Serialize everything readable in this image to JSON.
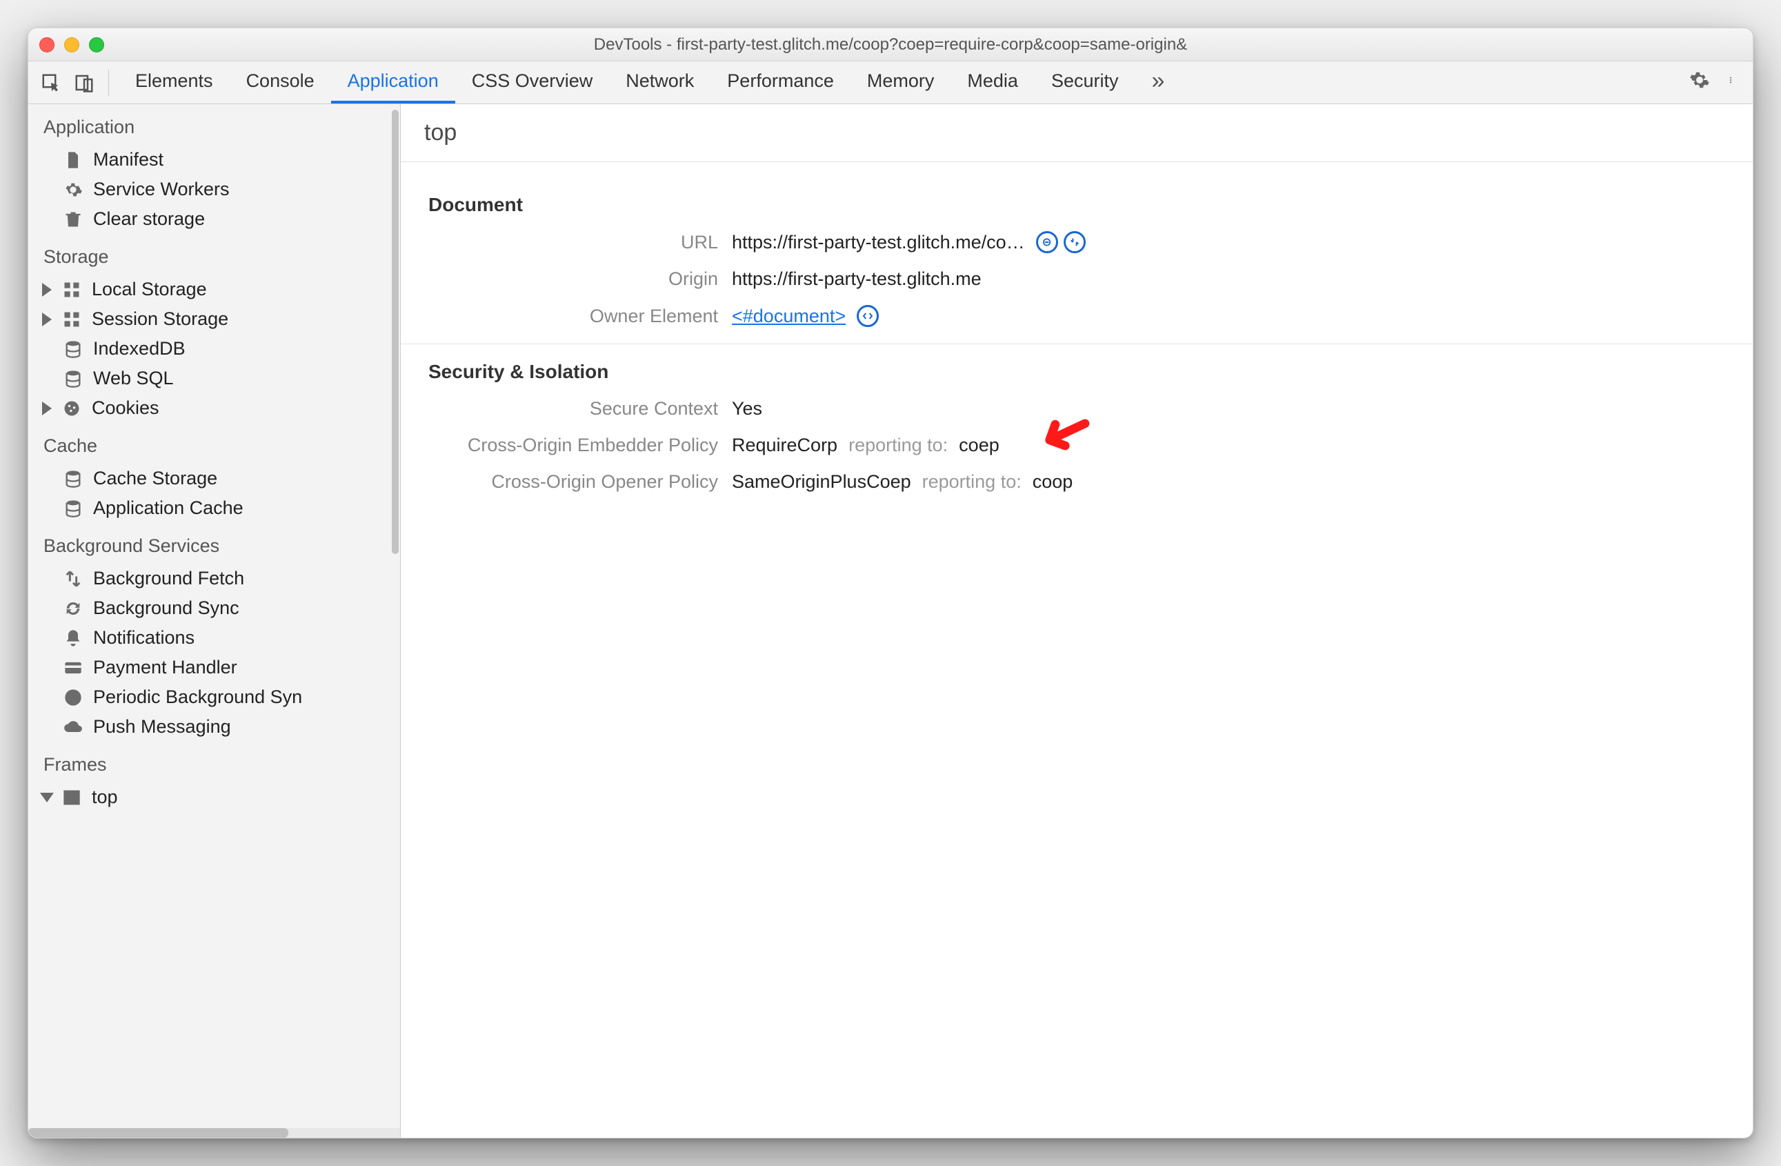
{
  "window": {
    "title": "DevTools - first-party-test.glitch.me/coop?coep=require-corp&coop=same-origin&"
  },
  "tabs": {
    "items": [
      "Elements",
      "Console",
      "Application",
      "CSS Overview",
      "Network",
      "Performance",
      "Memory",
      "Media",
      "Security"
    ],
    "active": "Application",
    "overflow_glyph": "»"
  },
  "sidebar": {
    "groups": [
      {
        "title": "Application",
        "items": [
          {
            "icon": "file",
            "label": "Manifest"
          },
          {
            "icon": "gear",
            "label": "Service Workers"
          },
          {
            "icon": "trash",
            "label": "Clear storage"
          }
        ]
      },
      {
        "title": "Storage",
        "items": [
          {
            "arrow": true,
            "icon": "grid",
            "label": "Local Storage"
          },
          {
            "arrow": true,
            "icon": "grid",
            "label": "Session Storage"
          },
          {
            "icon": "db",
            "label": "IndexedDB"
          },
          {
            "icon": "db",
            "label": "Web SQL"
          },
          {
            "arrow": true,
            "icon": "cookie",
            "label": "Cookies"
          }
        ]
      },
      {
        "title": "Cache",
        "items": [
          {
            "icon": "db",
            "label": "Cache Storage"
          },
          {
            "icon": "db",
            "label": "Application Cache"
          }
        ]
      },
      {
        "title": "Background Services",
        "items": [
          {
            "icon": "updown",
            "label": "Background Fetch"
          },
          {
            "icon": "sync",
            "label": "Background Sync"
          },
          {
            "icon": "bell",
            "label": "Notifications"
          },
          {
            "icon": "card",
            "label": "Payment Handler"
          },
          {
            "icon": "clock",
            "label": "Periodic Background Syn"
          },
          {
            "icon": "cloud",
            "label": "Push Messaging"
          }
        ]
      },
      {
        "title": "Frames",
        "items": [
          {
            "arrow": true,
            "arrow_open": true,
            "icon": "window",
            "label": "top"
          }
        ]
      }
    ]
  },
  "main": {
    "heading": "top",
    "document": {
      "section_title": "Document",
      "url_label": "URL",
      "url_value": "https://first-party-test.glitch.me/co…",
      "origin_label": "Origin",
      "origin_value": "https://first-party-test.glitch.me",
      "owner_label": "Owner Element",
      "owner_link": "<#document>"
    },
    "security": {
      "section_title": "Security & Isolation",
      "secure_label": "Secure Context",
      "secure_value": "Yes",
      "coep_label": "Cross-Origin Embedder Policy",
      "coep_value": "RequireCorp",
      "coep_reporting_label": "reporting to:",
      "coep_reporting_value": "coep",
      "coop_label": "Cross-Origin Opener Policy",
      "coop_value": "SameOriginPlusCoep",
      "coop_reporting_label": "reporting to:",
      "coop_reporting_value": "coop"
    }
  }
}
